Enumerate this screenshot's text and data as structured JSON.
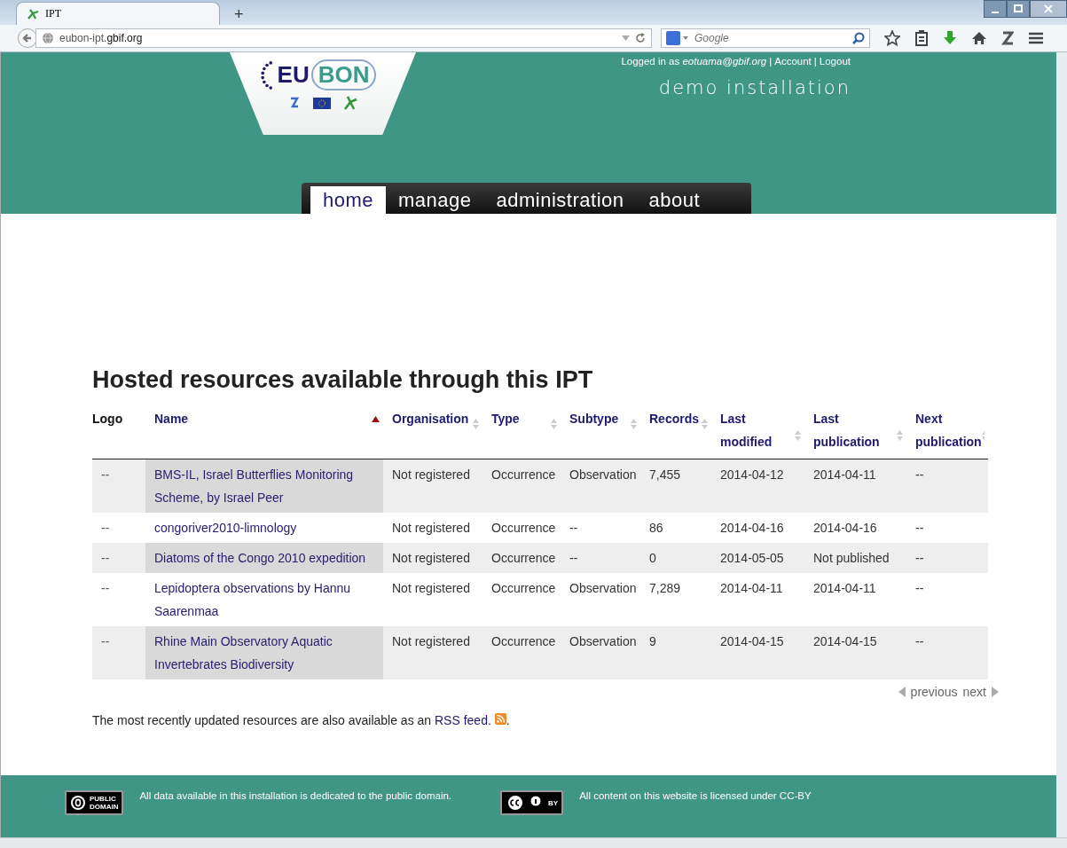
{
  "browser": {
    "tab": {
      "title": "IPT",
      "selected": true
    },
    "new_tab": "+",
    "url": {
      "host": "eubon-ipt.",
      "domain": "gbif.org"
    },
    "search": {
      "placeholder": "Google"
    }
  },
  "header": {
    "logo": {
      "left": "EU",
      "right": "BON"
    },
    "login": {
      "text": "Logged in as *eotuama@gbif.org*",
      "separator": "|",
      "links": [
        "Account",
        "Logout"
      ]
    },
    "subtitle": "demo installation"
  },
  "nav": [
    {
      "label": "home",
      "selected": true
    },
    {
      "label": "manage",
      "selected": false
    },
    {
      "label": "administration",
      "selected": false
    },
    {
      "label": "about",
      "selected": false
    }
  ],
  "heading": "Hosted resources available through this IPT",
  "table": {
    "columns": [
      {
        "label": "Logo",
        "sortable": false,
        "sorted": false
      },
      {
        "label": "Name",
        "sortable": true,
        "sorted": true
      },
      {
        "label": "Organisation",
        "sortable": true,
        "sorted": false
      },
      {
        "label": "Type",
        "sortable": true,
        "sorted": false
      },
      {
        "label": "Subtype",
        "sortable": true,
        "sorted": false
      },
      {
        "label": "Records",
        "sortable": true,
        "sorted": false
      },
      {
        "label": "Last modified",
        "sortable": true,
        "sorted": false
      },
      {
        "label": "Last publication",
        "sortable": true,
        "sorted": false
      },
      {
        "label": "Next publication",
        "sortable": true,
        "sorted": false
      }
    ],
    "rows": [
      [
        "--",
        "BMS-IL, Israel Butterflies Monitoring Scheme, by Israel Peer",
        "Not registered",
        "Occurrence",
        "Observation",
        "7,455",
        "2014-04-12",
        "2014-04-11",
        "--"
      ],
      [
        "--",
        "congoriver2010-limnology",
        "Not registered",
        "Occurrence",
        "--",
        "86",
        "2014-04-16",
        "2014-04-16",
        "--"
      ],
      [
        "--",
        "Diatoms of the Congo 2010 expedition",
        "Not registered",
        "Occurrence",
        "--",
        "0",
        "2014-05-05",
        "Not published",
        "--"
      ],
      [
        "--",
        "Lepidoptera observations by Hannu Saarenmaa",
        "Not registered",
        "Occurrence",
        "Observation",
        "7,289",
        "2014-04-11",
        "2014-04-11",
        "--"
      ],
      [
        "--",
        "Rhine Main Observatory Aquatic Invertebrates Biodiversity",
        "Not registered",
        "Occurrence",
        "Observation",
        "9",
        "2014-04-15",
        "2014-04-15",
        "--"
      ]
    ],
    "pager": {
      "previous": "previous",
      "next": "next"
    }
  },
  "rss": {
    "text": "The most recently updated resources are also available as an",
    "link": "RSS feed",
    "after": ".",
    "end": "."
  },
  "footer": [
    {
      "badge": [
        "PUBLIC",
        "DOMAIN"
      ],
      "text": "All data available in this installation is dedicated to the public domain."
    },
    {
      "badge": [
        "BY"
      ],
      "text": "All content on this website is licensed under CC-BY"
    }
  ]
}
